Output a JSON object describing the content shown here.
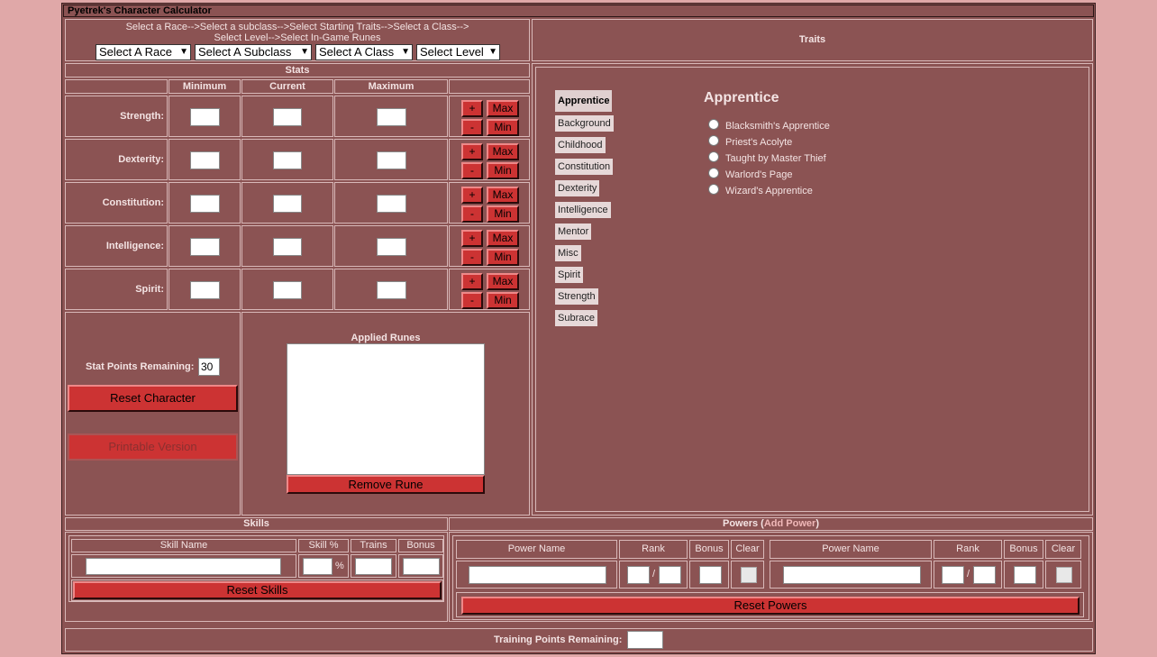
{
  "app": {
    "title": "Pyetrek's Character Calculator"
  },
  "selector": {
    "instructions_line1": "Select a Race-->Select a subclass-->Select Starting Traits-->Select a Class-->",
    "instructions_line2": "Select Level-->Select In-Game Runes",
    "race": "Select A Race",
    "subclass": "Select A Subclass",
    "class": "Select A Class",
    "level": "Select Level"
  },
  "stats": {
    "header": "Stats",
    "columns": [
      "Minimum",
      "Current",
      "Maximum"
    ],
    "rows": [
      {
        "label": "Strength:"
      },
      {
        "label": "Dexterity:"
      },
      {
        "label": "Constitution:"
      },
      {
        "label": "Intelligence:"
      },
      {
        "label": "Spirit:"
      }
    ],
    "plus": "+",
    "minus": "-",
    "max": "Max",
    "min": "Min",
    "points_label": "Stat Points Remaining:",
    "points_value": "30",
    "reset_label": "Reset Character",
    "printable_label": "Printable Version"
  },
  "runes": {
    "header": "Applied Runes",
    "remove_label": "Remove Rune"
  },
  "traits": {
    "header": "Traits",
    "categories": [
      "Apprentice",
      "Background",
      "Childhood",
      "Constitution",
      "Dexterity",
      "Intelligence",
      "Mentor",
      "Misc",
      "Spirit",
      "Strength",
      "Subrace"
    ],
    "selected_category": "Apprentice",
    "options_title": "Apprentice",
    "options": [
      "Blacksmith's Apprentice",
      "Priest's Acolyte",
      "Taught by Master Thief",
      "Warlord's Page",
      "Wizard's Apprentice"
    ]
  },
  "skills": {
    "header": "Skills",
    "columns": [
      "Skill Name",
      "Skill %",
      "Trains",
      "Bonus"
    ],
    "percent": "%",
    "reset_label": "Reset Skills"
  },
  "powers": {
    "header_prefix": "Powers (",
    "add_link": "Add Power",
    "header_suffix": ")",
    "columns": [
      "Power Name",
      "Rank",
      "Bonus",
      "Clear",
      "Power Name",
      "Rank",
      "Bonus",
      "Clear"
    ],
    "slash": "/",
    "reset_label": "Reset Powers"
  },
  "training": {
    "label": "Training Points Remaining:",
    "value": ""
  },
  "colors": {
    "page_bg": "#e0a8a8",
    "panel_bg": "#8b5353",
    "button_red": "#cc3333",
    "link": "#f0b8b8"
  }
}
